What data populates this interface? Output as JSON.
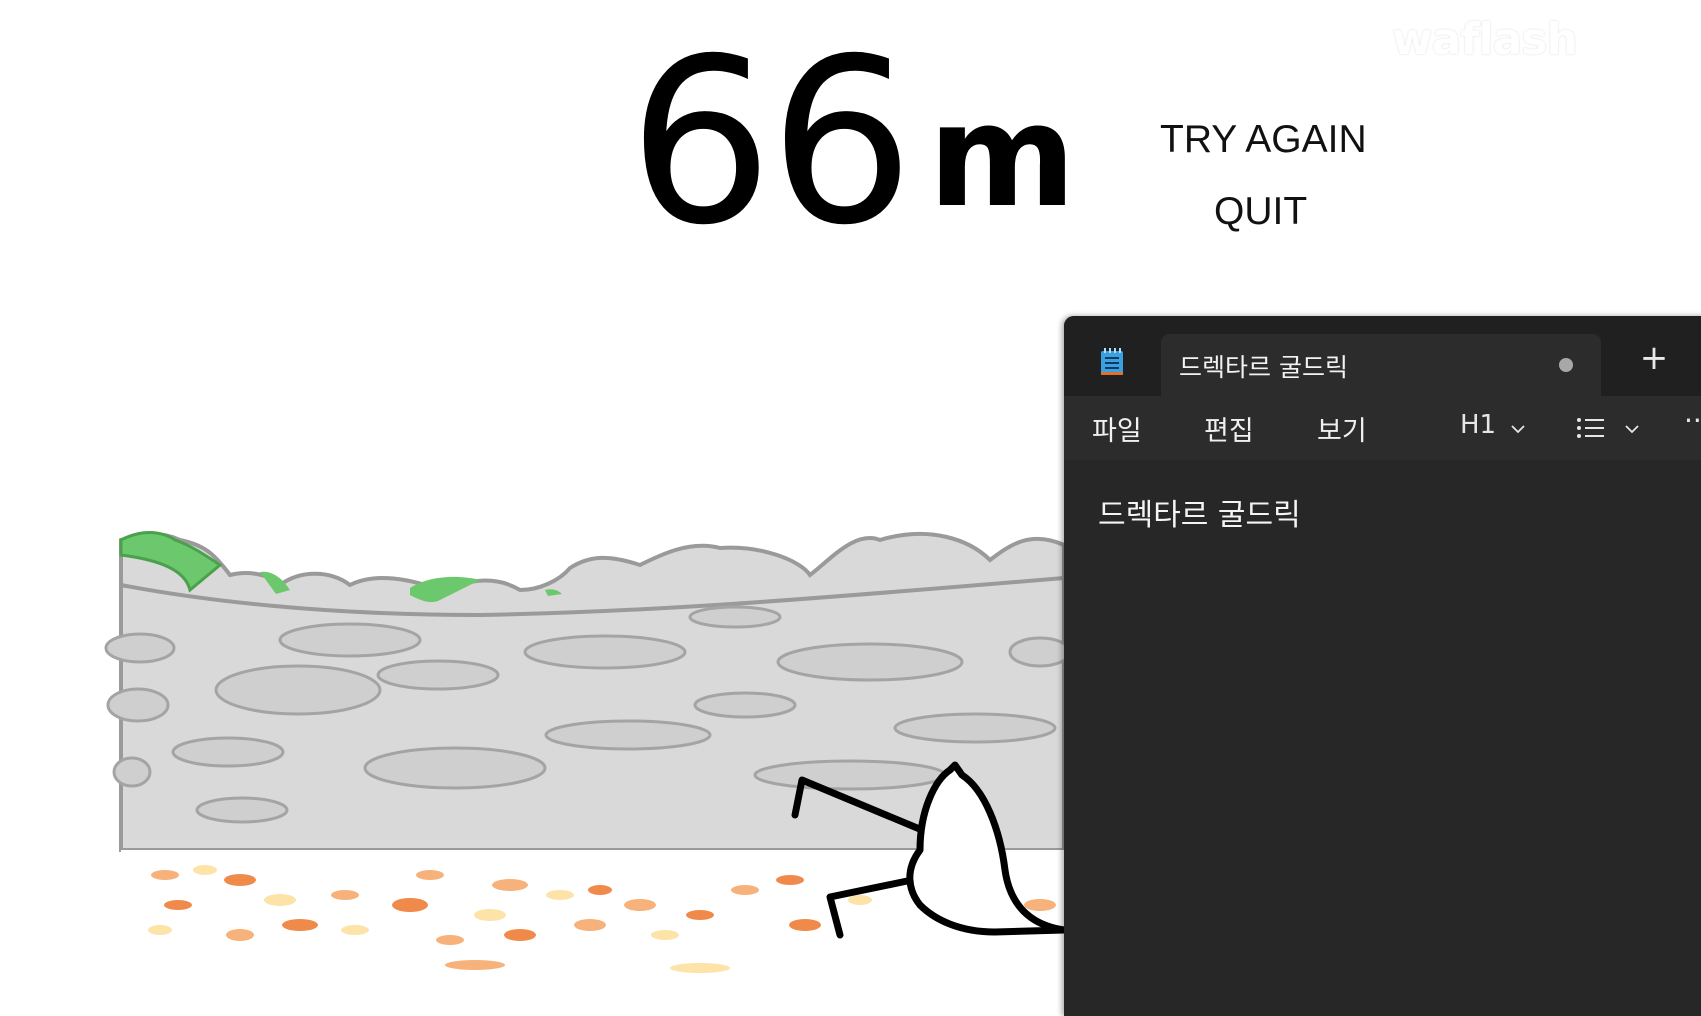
{
  "game": {
    "distance_value": "66",
    "distance_unit": "m",
    "try_again_label": "TRY AGAIN",
    "quit_label": "QUIT",
    "watermark": "waflash"
  },
  "notepad": {
    "tab_title": "드렉타르 굴드릭",
    "unsaved_indicator": "●",
    "new_tab_label": "+",
    "menus": [
      "파일",
      "편집",
      "보기"
    ],
    "heading_selector": "H1",
    "more_label": "···",
    "document_text": "드렉타르 굴드릭",
    "icons": {
      "app": "notepad-icon",
      "heading_dropdown": "chevron-down-icon",
      "list": "list-icon",
      "list_dropdown": "chevron-down-icon"
    },
    "colors": {
      "titlebar": "#202020",
      "tab": "#2c2c2c",
      "editor": "#272727",
      "text": "#f4f4f4"
    }
  },
  "scene_colors": {
    "wall": "#d6d6d6",
    "wall_outline": "#9a9a9a",
    "moss": "#6cc86c",
    "leaves": [
      "#f08a4b",
      "#f6b27a",
      "#fde3a8"
    ]
  }
}
